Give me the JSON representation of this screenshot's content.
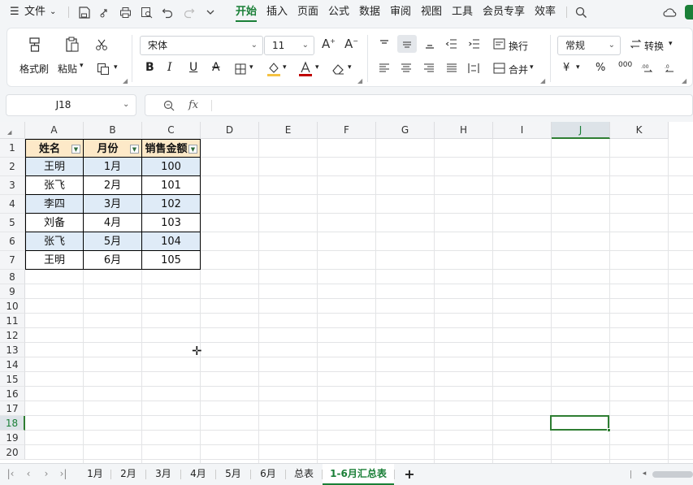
{
  "menubar": {
    "file_label": "文件",
    "tabs": [
      "开始",
      "插入",
      "页面",
      "公式",
      "数据",
      "审阅",
      "视图",
      "工具",
      "会员专享",
      "效率"
    ],
    "active_tab": "开始"
  },
  "ribbon": {
    "format_painter": "格式刷",
    "paste": "粘贴",
    "font_name": "宋体",
    "font_size": "11",
    "wrap_text": "换行",
    "merge": "合并",
    "number_format": "常规",
    "convert": "转换",
    "currency_symbol": "¥",
    "percent_symbol": "%",
    "thousands_symbol": "000"
  },
  "formula_bar": {
    "name_box": "J18",
    "fx_label": "fx",
    "formula": ""
  },
  "sheet": {
    "columns": [
      "A",
      "B",
      "C",
      "D",
      "E",
      "F",
      "G",
      "H",
      "I",
      "J",
      "K"
    ],
    "active_column": "J",
    "rows": [
      "1",
      "2",
      "3",
      "4",
      "5",
      "6",
      "7",
      "8",
      "9",
      "10",
      "11",
      "12",
      "13",
      "14",
      "15",
      "16",
      "17",
      "18",
      "19",
      "20"
    ],
    "active_row": "18",
    "headers": [
      "姓名",
      "月份",
      "销售金额"
    ],
    "data": [
      [
        "王明",
        "1月",
        "100"
      ],
      [
        "张飞",
        "2月",
        "101"
      ],
      [
        "李四",
        "3月",
        "102"
      ],
      [
        "刘备",
        "4月",
        "103"
      ],
      [
        "张飞",
        "5月",
        "104"
      ],
      [
        "王明",
        "6月",
        "105"
      ]
    ]
  },
  "sheet_tabs": {
    "tabs": [
      "1月",
      "2月",
      "3月",
      "4月",
      "5月",
      "6月",
      "总表",
      "1-6月汇总表"
    ],
    "active": "1-6月汇总表",
    "add_label": "+"
  },
  "colors": {
    "accent": "#1a7f37",
    "header_fill": "#fde9c8",
    "band_fill": "#dfebf7"
  }
}
